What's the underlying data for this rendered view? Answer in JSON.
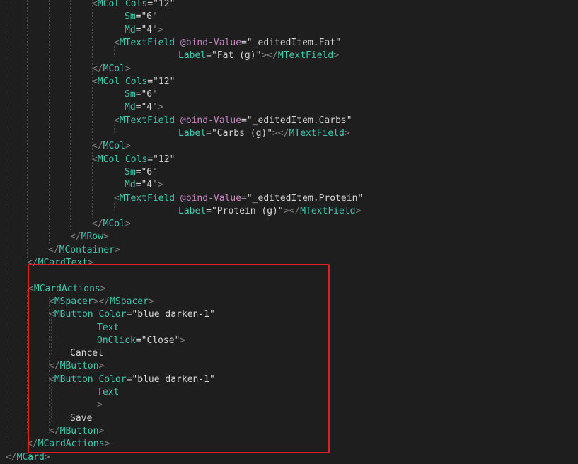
{
  "colors": {
    "background": "#1e1e1e",
    "tag": "#3dc9b0",
    "attribute": "#3dc9b0",
    "directive": "#c586c0",
    "string": "#d4d4d4",
    "punctuation": "#808080",
    "text": "#d4d4d4",
    "highlight_border": "#e02020"
  },
  "code_lines": [
    [
      {
        "t": "<",
        "c": "punct"
      },
      {
        "t": "MCol",
        "c": "tag"
      },
      {
        "t": " Cols",
        "c": "attr"
      },
      {
        "t": "=",
        "c": "eq"
      },
      {
        "t": "\"12\"",
        "c": "str"
      }
    ],
    [
      {
        "t": "Sm",
        "c": "attr"
      },
      {
        "t": "=",
        "c": "eq"
      },
      {
        "t": "\"6\"",
        "c": "str"
      }
    ],
    [
      {
        "t": "Md",
        "c": "attr"
      },
      {
        "t": "=",
        "c": "eq"
      },
      {
        "t": "\"4\"",
        "c": "str"
      },
      {
        "t": ">",
        "c": "punct"
      }
    ],
    [
      {
        "t": "<",
        "c": "punct"
      },
      {
        "t": "MTextField",
        "c": "tag"
      },
      {
        "t": " @bind-Value",
        "c": "directive"
      },
      {
        "t": "=",
        "c": "eq"
      },
      {
        "t": "\"_editedItem.Fat\"",
        "c": "str"
      }
    ],
    [
      {
        "t": "Label",
        "c": "attr"
      },
      {
        "t": "=",
        "c": "eq"
      },
      {
        "t": "\"Fat (g)\"",
        "c": "str"
      },
      {
        "t": "></",
        "c": "punct"
      },
      {
        "t": "MTextField",
        "c": "tag"
      },
      {
        "t": ">",
        "c": "punct"
      }
    ],
    [
      {
        "t": "</",
        "c": "punct"
      },
      {
        "t": "MCol",
        "c": "tag"
      },
      {
        "t": ">",
        "c": "punct"
      }
    ],
    [
      {
        "t": "<",
        "c": "punct"
      },
      {
        "t": "MCol",
        "c": "tag"
      },
      {
        "t": " Cols",
        "c": "attr"
      },
      {
        "t": "=",
        "c": "eq"
      },
      {
        "t": "\"12\"",
        "c": "str"
      }
    ],
    [
      {
        "t": "Sm",
        "c": "attr"
      },
      {
        "t": "=",
        "c": "eq"
      },
      {
        "t": "\"6\"",
        "c": "str"
      }
    ],
    [
      {
        "t": "Md",
        "c": "attr"
      },
      {
        "t": "=",
        "c": "eq"
      },
      {
        "t": "\"4\"",
        "c": "str"
      },
      {
        "t": ">",
        "c": "punct"
      }
    ],
    [
      {
        "t": "<",
        "c": "punct"
      },
      {
        "t": "MTextField",
        "c": "tag"
      },
      {
        "t": " @bind-Value",
        "c": "directive"
      },
      {
        "t": "=",
        "c": "eq"
      },
      {
        "t": "\"_editedItem.Carbs\"",
        "c": "str"
      }
    ],
    [
      {
        "t": "Label",
        "c": "attr"
      },
      {
        "t": "=",
        "c": "eq"
      },
      {
        "t": "\"Carbs (g)\"",
        "c": "str"
      },
      {
        "t": "></",
        "c": "punct"
      },
      {
        "t": "MTextField",
        "c": "tag"
      },
      {
        "t": ">",
        "c": "punct"
      }
    ],
    [
      {
        "t": "</",
        "c": "punct"
      },
      {
        "t": "MCol",
        "c": "tag"
      },
      {
        "t": ">",
        "c": "punct"
      }
    ],
    [
      {
        "t": "<",
        "c": "punct"
      },
      {
        "t": "MCol",
        "c": "tag"
      },
      {
        "t": " Cols",
        "c": "attr"
      },
      {
        "t": "=",
        "c": "eq"
      },
      {
        "t": "\"12\"",
        "c": "str"
      }
    ],
    [
      {
        "t": "Sm",
        "c": "attr"
      },
      {
        "t": "=",
        "c": "eq"
      },
      {
        "t": "\"6\"",
        "c": "str"
      }
    ],
    [
      {
        "t": "Md",
        "c": "attr"
      },
      {
        "t": "=",
        "c": "eq"
      },
      {
        "t": "\"4\"",
        "c": "str"
      },
      {
        "t": ">",
        "c": "punct"
      }
    ],
    [
      {
        "t": "<",
        "c": "punct"
      },
      {
        "t": "MTextField",
        "c": "tag"
      },
      {
        "t": " @bind-Value",
        "c": "directive"
      },
      {
        "t": "=",
        "c": "eq"
      },
      {
        "t": "\"_editedItem.Protein\"",
        "c": "str"
      }
    ],
    [
      {
        "t": "Label",
        "c": "attr"
      },
      {
        "t": "=",
        "c": "eq"
      },
      {
        "t": "\"Protein (g)\"",
        "c": "str"
      },
      {
        "t": "></",
        "c": "punct"
      },
      {
        "t": "MTextField",
        "c": "tag"
      },
      {
        "t": ">",
        "c": "punct"
      }
    ],
    [
      {
        "t": "</",
        "c": "punct"
      },
      {
        "t": "MCol",
        "c": "tag"
      },
      {
        "t": ">",
        "c": "punct"
      }
    ],
    [
      {
        "t": "</",
        "c": "punct"
      },
      {
        "t": "MRow",
        "c": "tag"
      },
      {
        "t": ">",
        "c": "punct"
      }
    ],
    [
      {
        "t": "</",
        "c": "punct"
      },
      {
        "t": "MContainer",
        "c": "tag"
      },
      {
        "t": ">",
        "c": "punct"
      }
    ],
    [
      {
        "t": "</",
        "c": "punct"
      },
      {
        "t": "MCardText",
        "c": "tag"
      },
      {
        "t": ">",
        "c": "punct"
      }
    ],
    [],
    [
      {
        "t": "<",
        "c": "punct"
      },
      {
        "t": "MCardActions",
        "c": "tag"
      },
      {
        "t": ">",
        "c": "punct"
      }
    ],
    [
      {
        "t": "<",
        "c": "punct"
      },
      {
        "t": "MSpacer",
        "c": "tag"
      },
      {
        "t": "></",
        "c": "punct"
      },
      {
        "t": "MSpacer",
        "c": "tag"
      },
      {
        "t": ">",
        "c": "punct"
      }
    ],
    [
      {
        "t": "<",
        "c": "punct"
      },
      {
        "t": "MButton",
        "c": "tag"
      },
      {
        "t": " Color",
        "c": "attr"
      },
      {
        "t": "=",
        "c": "eq"
      },
      {
        "t": "\"blue darken-1\"",
        "c": "str"
      }
    ],
    [
      {
        "t": "Text",
        "c": "attr"
      }
    ],
    [
      {
        "t": "OnClick",
        "c": "attr"
      },
      {
        "t": "=",
        "c": "eq"
      },
      {
        "t": "\"Close\"",
        "c": "str"
      },
      {
        "t": ">",
        "c": "punct"
      }
    ],
    [
      {
        "t": "Cancel",
        "c": "text"
      }
    ],
    [
      {
        "t": "</",
        "c": "punct"
      },
      {
        "t": "MButton",
        "c": "tag"
      },
      {
        "t": ">",
        "c": "punct"
      }
    ],
    [
      {
        "t": "<",
        "c": "punct"
      },
      {
        "t": "MButton",
        "c": "tag"
      },
      {
        "t": " Color",
        "c": "attr"
      },
      {
        "t": "=",
        "c": "eq"
      },
      {
        "t": "\"blue darken-1\"",
        "c": "str"
      }
    ],
    [
      {
        "t": "Text",
        "c": "attr"
      }
    ],
    [
      {
        "t": ">",
        "c": "punct"
      }
    ],
    [
      {
        "t": "Save",
        "c": "text"
      }
    ],
    [
      {
        "t": "</",
        "c": "punct"
      },
      {
        "t": "MButton",
        "c": "tag"
      },
      {
        "t": ">",
        "c": "punct"
      }
    ],
    [
      {
        "t": "</",
        "c": "punct"
      },
      {
        "t": "MCardActions",
        "c": "tag"
      },
      {
        "t": ">",
        "c": "punct"
      }
    ],
    [
      {
        "t": "</",
        "c": "punct"
      },
      {
        "t": "MCard",
        "c": "tag"
      },
      {
        "t": ">",
        "c": "punct"
      }
    ]
  ]
}
